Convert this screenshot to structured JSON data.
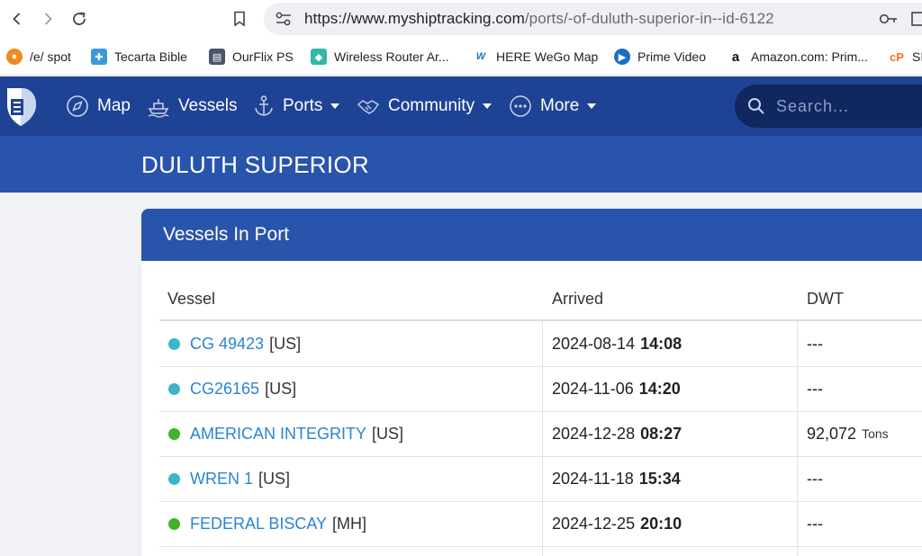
{
  "browser": {
    "url_host": "https://www.myshiptracking.com",
    "url_path": "/ports/-of-duluth-superior-in--id-6122",
    "bookmarks": [
      {
        "label": "/e/ spot",
        "icon": "spot-icon",
        "color": "#f08a1c"
      },
      {
        "label": "Tecarta Bible",
        "icon": "bible-icon",
        "color": "#3a9ad9"
      },
      {
        "label": "OurFlix PS",
        "icon": "ourflix-icon",
        "color": "#4a5568"
      },
      {
        "label": "Wireless Router Ar...",
        "icon": "router-icon",
        "color": "#35b6a9"
      },
      {
        "label": "HERE WeGo Map",
        "icon": "here-icon",
        "color": "#1a73c9"
      },
      {
        "label": "Prime Video",
        "icon": "prime-icon",
        "color": "#1b6ec2"
      },
      {
        "label": "Amazon.com: Prim...",
        "icon": "amazon-icon",
        "color": "#111111"
      },
      {
        "label": "SI",
        "icon": "cpanel-icon",
        "color": "#ff6c2c"
      }
    ]
  },
  "nav": {
    "items": [
      {
        "label": "Map",
        "icon": "compass-icon"
      },
      {
        "label": "Vessels",
        "icon": "ship-icon"
      },
      {
        "label": "Ports",
        "icon": "anchor-icon"
      },
      {
        "label": "Community",
        "icon": "handshake-icon"
      },
      {
        "label": "More",
        "icon": "more-dots-icon"
      }
    ],
    "search_placeholder": "Search..."
  },
  "page": {
    "title": "DULUTH SUPERIOR",
    "card_title": "Vessels In Port"
  },
  "table": {
    "columns": [
      "Vessel",
      "Arrived",
      "DWT"
    ],
    "rows": [
      {
        "name": "CG 49423",
        "flag": "[US]",
        "date": "2024-08-14",
        "time": "14:08",
        "dwt": "---",
        "dwt_unit": "",
        "status_color": "#3bb6c8"
      },
      {
        "name": "CG26165",
        "flag": "[US]",
        "date": "2024-11-06",
        "time": "14:20",
        "dwt": "---",
        "dwt_unit": "",
        "status_color": "#3bb6c8"
      },
      {
        "name": "AMERICAN INTEGRITY",
        "flag": "[US]",
        "date": "2024-12-28",
        "time": "08:27",
        "dwt": "92,072",
        "dwt_unit": "Tons",
        "status_color": "#43b02a"
      },
      {
        "name": "WREN 1",
        "flag": "[US]",
        "date": "2024-11-18",
        "time": "15:34",
        "dwt": "---",
        "dwt_unit": "",
        "status_color": "#3bb6c8"
      },
      {
        "name": "FEDERAL BISCAY",
        "flag": "[MH]",
        "date": "2024-12-25",
        "time": "20:10",
        "dwt": "---",
        "dwt_unit": "",
        "status_color": "#43b02a"
      }
    ]
  }
}
